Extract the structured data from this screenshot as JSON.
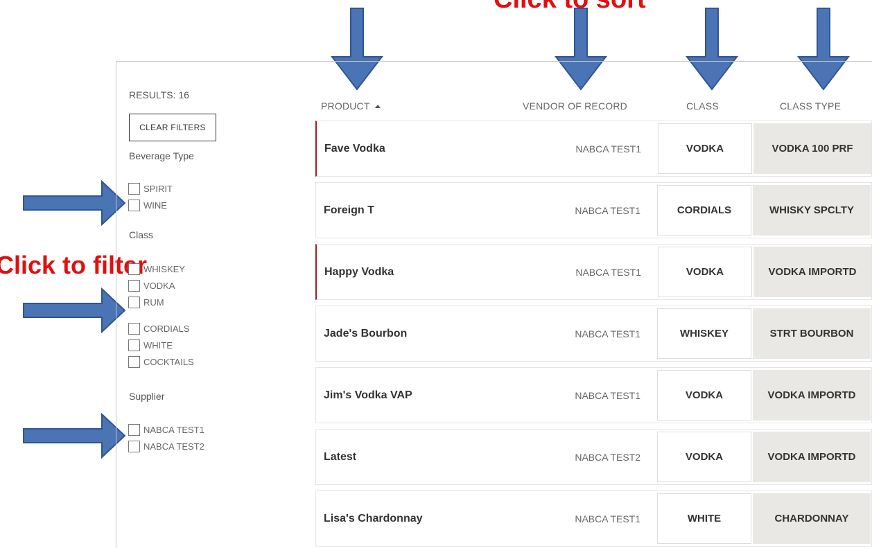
{
  "annotations": {
    "sort_text": "Click to sort",
    "filter_text": "Click to filter",
    "arrow_color": "#4a74b4"
  },
  "sidebar": {
    "results_label": "RESULTS: 16",
    "clear_filters_label": "CLEAR FILTERS",
    "facets": [
      {
        "title": "Beverage Type",
        "options": [
          "SPIRIT",
          "WINE"
        ]
      },
      {
        "title": "Class",
        "options": [
          "WHISKEY",
          "VODKA",
          "RUM",
          "CORDIALS",
          "WHITE",
          "COCKTAILS"
        ]
      },
      {
        "title": "Supplier",
        "options": [
          "NABCA TEST1",
          "NABCA TEST2"
        ]
      }
    ]
  },
  "table": {
    "headers": {
      "product": "PRODUCT",
      "vendor": "VENDOR OF RECORD",
      "class": "CLASS",
      "class_type": "CLASS TYPE"
    },
    "sort_indicator": "ascending",
    "accent_color": "#a01e24",
    "rows": [
      {
        "product": "Fave Vodka",
        "vendor": "NABCA TEST1",
        "class": "VODKA",
        "class_type": "VODKA 100 PRF"
      },
      {
        "product": "Foreign T",
        "vendor": "NABCA TEST1",
        "class": "CORDIALS",
        "class_type": "WHISKY SPCLTY"
      },
      {
        "product": "Happy Vodka",
        "vendor": "NABCA TEST1",
        "class": "VODKA",
        "class_type": "VODKA IMPORTD"
      },
      {
        "product": "Jade's Bourbon",
        "vendor": "NABCA TEST1",
        "class": "WHISKEY",
        "class_type": "STRT BOURBON"
      },
      {
        "product": "Jim's Vodka VAP",
        "vendor": "NABCA TEST1",
        "class": "VODKA",
        "class_type": "VODKA IMPORTD"
      },
      {
        "product": "Latest",
        "vendor": "NABCA TEST2",
        "class": "VODKA",
        "class_type": "VODKA IMPORTD"
      },
      {
        "product": "Lisa's Chardonnay",
        "vendor": "NABCA TEST1",
        "class": "WHITE",
        "class_type": "CHARDONNAY"
      }
    ]
  }
}
